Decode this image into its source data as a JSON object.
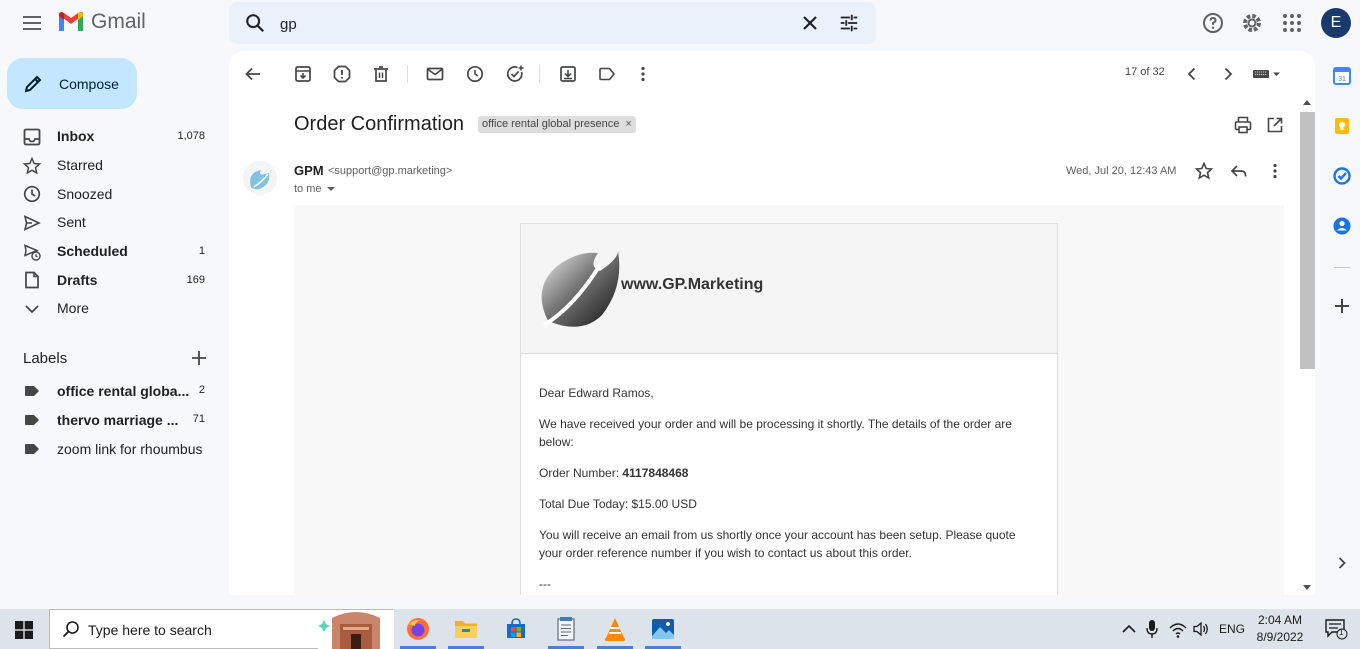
{
  "app": {
    "name": "Gmail"
  },
  "search": {
    "query": "gp"
  },
  "account": {
    "initial": "E"
  },
  "compose": {
    "label": "Compose"
  },
  "nav": [
    {
      "label": "Inbox",
      "count": "1,078",
      "bold": true,
      "icon": "inbox-icon"
    },
    {
      "label": "Starred",
      "count": "",
      "bold": false,
      "icon": "star-icon"
    },
    {
      "label": "Snoozed",
      "count": "",
      "bold": false,
      "icon": "clock-icon"
    },
    {
      "label": "Sent",
      "count": "",
      "bold": false,
      "icon": "send-icon"
    },
    {
      "label": "Scheduled",
      "count": "1",
      "bold": true,
      "icon": "scheduled-icon"
    },
    {
      "label": "Drafts",
      "count": "169",
      "bold": true,
      "icon": "draft-icon"
    },
    {
      "label": "More",
      "count": "",
      "bold": false,
      "icon": "chevron-down-icon"
    }
  ],
  "labels": {
    "heading": "Labels",
    "items": [
      {
        "label": "office rental globa...",
        "count": "2",
        "bold": true
      },
      {
        "label": "thervo marriage ...",
        "count": "71",
        "bold": true
      },
      {
        "label": "zoom link for rhoumbus",
        "count": "",
        "bold": false
      }
    ]
  },
  "toolbar": {
    "pager": "17 of 32"
  },
  "email": {
    "subject": "Order Confirmation",
    "label_chip": "office rental global presence",
    "label_chip_close": "×",
    "sender_name": "GPM",
    "sender_email": "<support@gp.marketing>",
    "to": "to me",
    "date": "Wed, Jul 20, 12:43 AM",
    "brand": "www.GP.Marketing",
    "greeting": "Dear Edward Ramos,",
    "para1": "We have received your order and will be processing it shortly. The details of the order are below:",
    "order_label": "Order Number:",
    "order_number": "4117848468",
    "total": "Total Due Today: $15.00 USD",
    "para2": "You will receive an email from us shortly once your account has been setup. Please quote your order reference number if you wish to contact us about this order.",
    "separator": "---"
  },
  "taskbar": {
    "search_placeholder": "Type here to search",
    "lang": "ENG",
    "time": "2:04 AM",
    "date": "8/9/2022",
    "notif_count": "1"
  },
  "colors": {
    "compose_bg": "#c2e7ff",
    "search_bg": "#eaf1fb",
    "avatar_bg": "#1a3a6e",
    "page_bg": "#f6f8fc"
  }
}
